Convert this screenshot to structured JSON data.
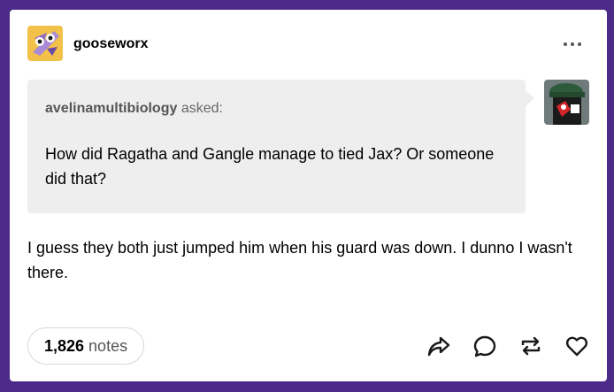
{
  "post": {
    "blog_name": "gooseworx",
    "ask": {
      "asker": "avelinamultibiology",
      "asked_label": "asked:",
      "question": "How did Ragatha and Gangle manage to tied Jax? Or someone did that?"
    },
    "answer": "I guess they both just jumped him when his guard was down. I dunno I wasn't there.",
    "notes": {
      "count": "1,826",
      "label": "notes"
    },
    "actions": [
      "share-icon",
      "reply-icon",
      "reblog-icon",
      "like-icon"
    ]
  },
  "colors": {
    "page_background": "#4b2a8a",
    "card": "#ffffff",
    "ask_bubble": "#eeeeee"
  }
}
